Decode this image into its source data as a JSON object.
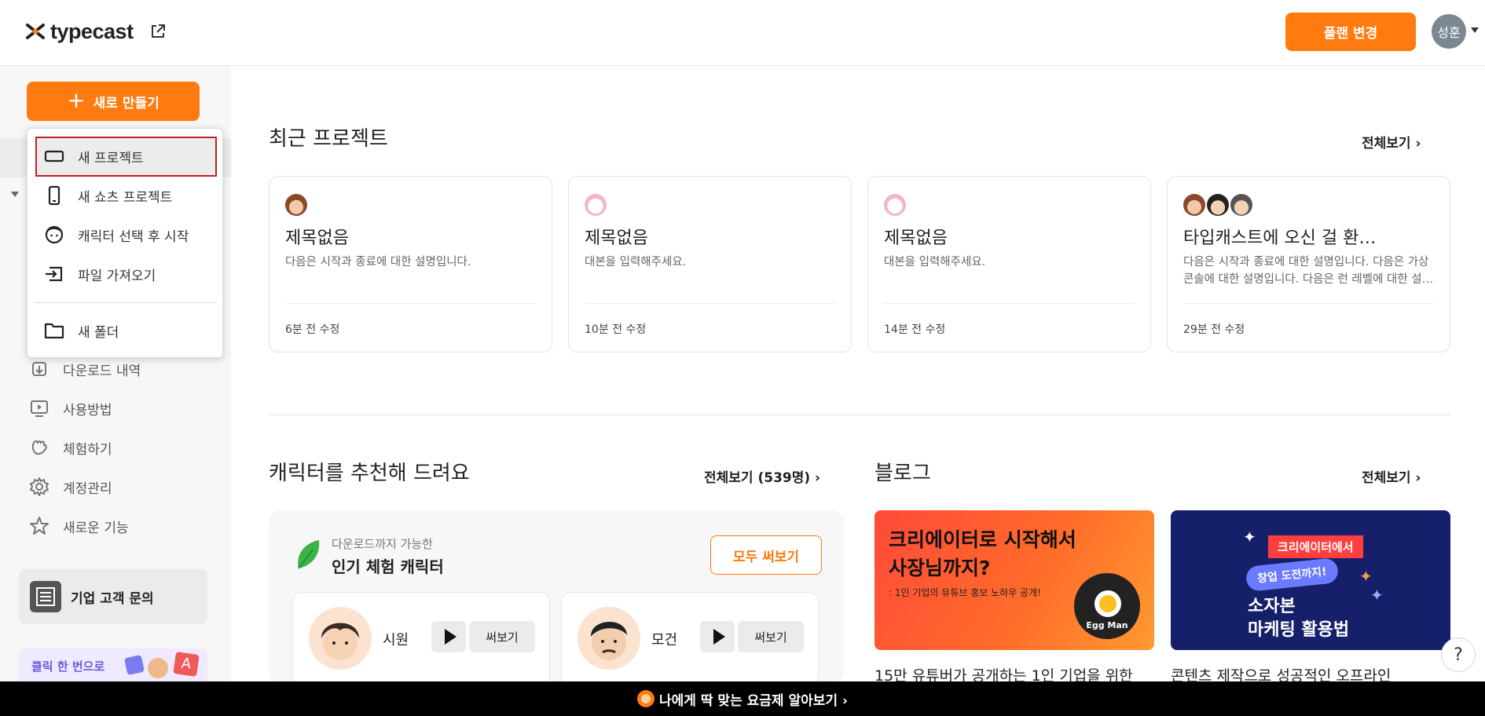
{
  "header": {
    "logo_text": "typecast",
    "plan_button": "플랜 변경",
    "avatar_text": "성훈"
  },
  "sidebar": {
    "new_button": "새로 만들기",
    "items": [
      {
        "label": "다운로드 내역",
        "icon": "download-history-icon"
      },
      {
        "label": "사용방법",
        "icon": "tutorial-icon"
      },
      {
        "label": "체험하기",
        "icon": "trial-icon"
      },
      {
        "label": "계정관리",
        "icon": "gear-icon"
      },
      {
        "label": "새로운 기능",
        "icon": "star-icon"
      }
    ],
    "corp_inquiry": "기업 고객 문의",
    "promo_text": "클릭 한 번으로"
  },
  "dropdown": {
    "items": [
      {
        "label": "새 프로젝트",
        "icon": "project-icon"
      },
      {
        "label": "새 쇼츠 프로젝트",
        "icon": "phone-icon"
      },
      {
        "label": "캐릭터 선택 후 시작",
        "icon": "character-icon"
      },
      {
        "label": "파일 가져오기",
        "icon": "import-icon"
      },
      {
        "label": "새 폴더",
        "icon": "folder-icon"
      }
    ]
  },
  "recent": {
    "title": "최근 프로젝트",
    "see_all": "전체보기 ›",
    "cards": [
      {
        "title": "제목없음",
        "desc": "다음은 시작과 종료에 대한 설명입니다.",
        "meta": "6분 전 수정"
      },
      {
        "title": "제목없음",
        "desc": "대본을 입력해주세요.",
        "meta": "10분 전 수정"
      },
      {
        "title": "제목없음",
        "desc": "대본을 입력해주세요.",
        "meta": "14분 전 수정"
      },
      {
        "title": "타입캐스트에 오신 걸 환…",
        "desc": "다음은 시작과 종료에 대한 설명입니다. 다음은 가상 콘솔에 대한 설명입니다. 다음은 런 레벨에 대한 설…",
        "meta": "29분 전 수정"
      }
    ]
  },
  "characters": {
    "title": "캐릭터를 추천해 드려요",
    "see_all": "전체보기 (539명) ›",
    "panel_sub": "다운로드까지 가능한",
    "panel_title": "인기 체험 캐릭터",
    "all_write": "모두 써보기",
    "write_label": "써보기",
    "list": [
      {
        "name": "시원"
      },
      {
        "name": "모건"
      }
    ]
  },
  "blog": {
    "title": "블로그",
    "see_all": "전체보기 ›",
    "posts": [
      {
        "banner_title_1": "크리에이터로 시작해서",
        "banner_title_2": "사장님까지?",
        "banner_sub": ": 1인 기업의 유튜브 홍보 노하우 공개!",
        "badge": "Egg Man",
        "title": "15만 유튜버가 공개하는 1인 기업을 위한"
      },
      {
        "tag1": "크리에이터에서",
        "tag2": "창업 도전까지!",
        "banner_title_1": "소자본",
        "banner_title_2": "마케팅 활용법",
        "title": "콘텐츠 제작으로 성공적인 오프라인"
      }
    ]
  },
  "help_label": "?",
  "bottom_bar": "나에게 딱 맞는 요금제 알아보기 ›",
  "colors": {
    "accent": "#ff7a0f",
    "selection_border": "#bb2222"
  }
}
